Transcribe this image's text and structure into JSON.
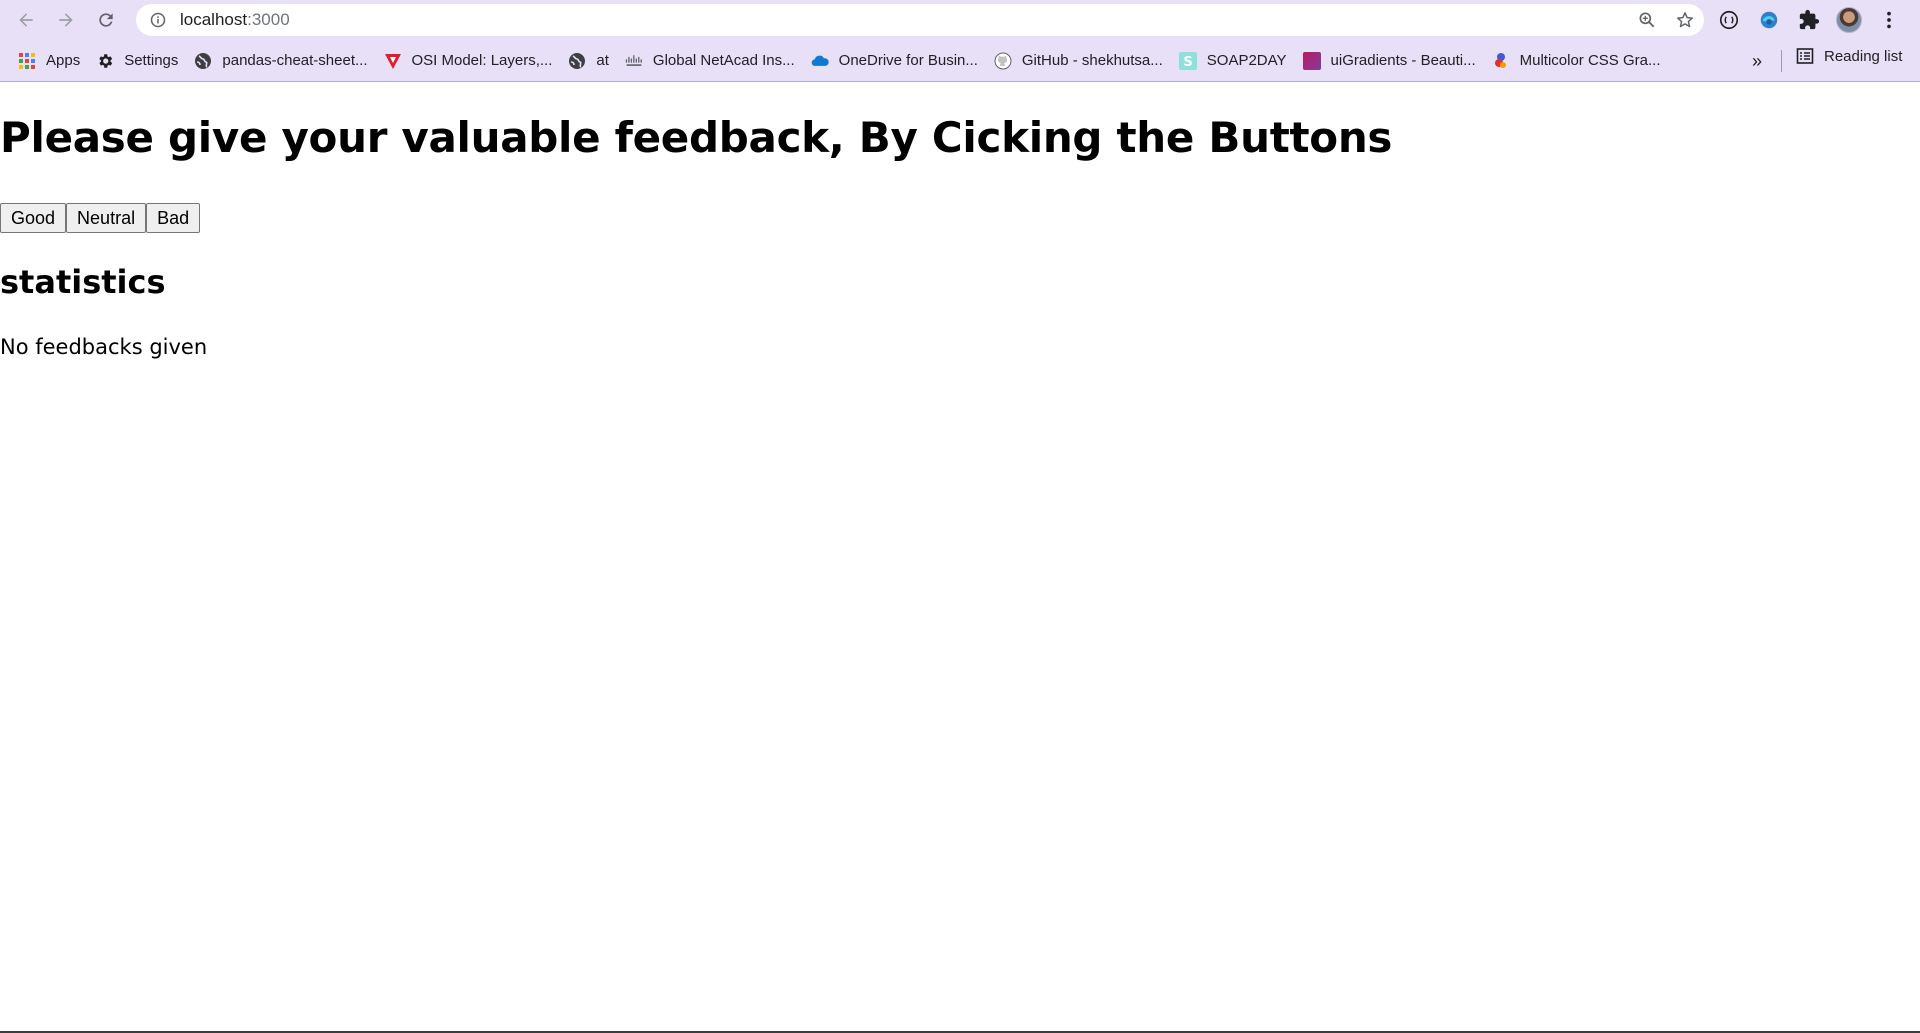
{
  "browser": {
    "url_host": "localhost",
    "url_port": ":3000",
    "bookmarks": [
      {
        "label": "Apps",
        "icon": "apps-grid-icon"
      },
      {
        "label": "Settings",
        "icon": "gear-icon"
      },
      {
        "label": "pandas-cheat-sheet...",
        "icon": "globe-icon"
      },
      {
        "label": "OSI Model: Layers,...",
        "icon": "red-v-icon"
      },
      {
        "label": "at",
        "icon": "globe-icon"
      },
      {
        "label": "Global NetAcad Ins...",
        "icon": "cisco-icon"
      },
      {
        "label": "OneDrive for Busin...",
        "icon": "cloud-icon"
      },
      {
        "label": "GitHub - shekhutsa...",
        "icon": "github-icon"
      },
      {
        "label": "SOAP2DAY",
        "icon": "s-badge-icon"
      },
      {
        "label": "uiGradients - Beauti...",
        "icon": "gradient-square-icon"
      },
      {
        "label": "Multicolor CSS Gra...",
        "icon": "multicolor-icon"
      }
    ],
    "more_bookmarks": "»",
    "reading_list": "Reading list"
  },
  "page": {
    "heading": "Please give your valuable feedback, By Cicking the Buttons",
    "buttons": {
      "good": "Good",
      "neutral": "Neutral",
      "bad": "Bad"
    },
    "statistics_heading": "statistics",
    "empty_message": "No feedbacks given"
  }
}
